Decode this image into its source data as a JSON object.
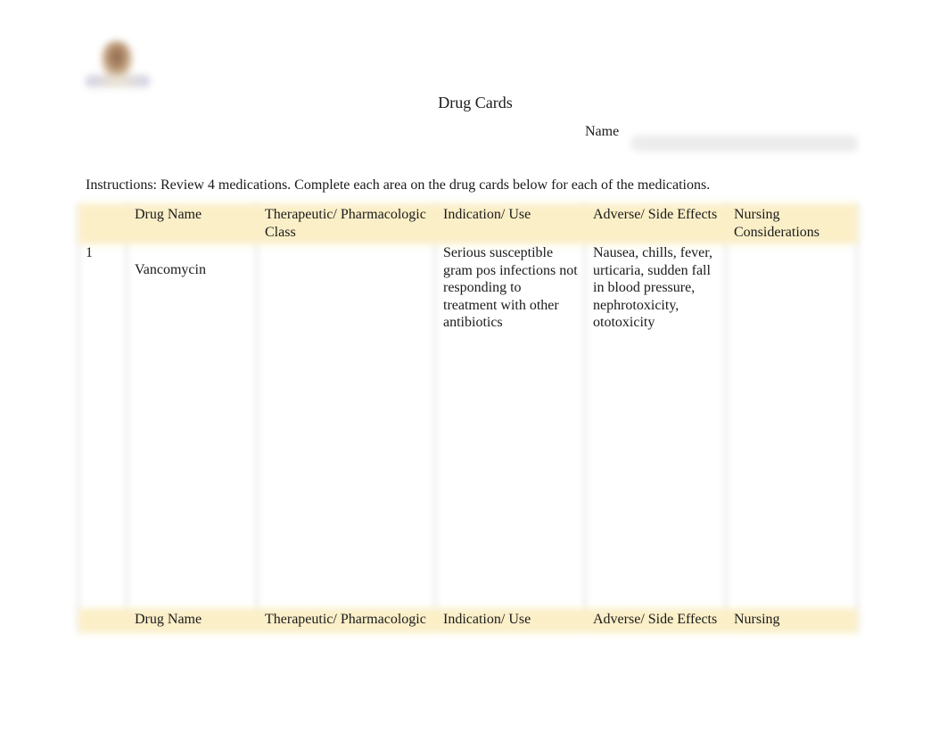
{
  "document": {
    "logo": {
      "icon": "university-seal-logo",
      "blurred": true
    },
    "title": "Drug Cards",
    "name_label": "Name",
    "name_value_redacted": true,
    "instructions": "Instructions: Review 4 medications.  Complete each area on the drug cards below for each of the medications."
  },
  "table": {
    "columns": [
      "",
      "Drug Name",
      "Therapeutic/ Pharmacologic Class",
      "Indication/ Use",
      "Adverse/ Side Effects",
      "Nursing Considerations"
    ],
    "header_color": "#fbefc8",
    "rows": [
      {
        "number": "1",
        "drug_name": "Vancomycin",
        "class": "",
        "indication": "Serious susceptible gram pos infections not responding to treatment with other antibiotics",
        "adverse_effects": "Nausea, chills, fever, urticaria, sudden fall in blood pressure, nephrotoxicity, ototoxicity",
        "nursing_considerations": ""
      }
    ],
    "second_header": [
      "",
      "Drug Name",
      "Therapeutic/ Pharmacologic",
      "Indication/ Use",
      "Adverse/ Side Effects",
      "Nursing"
    ]
  }
}
